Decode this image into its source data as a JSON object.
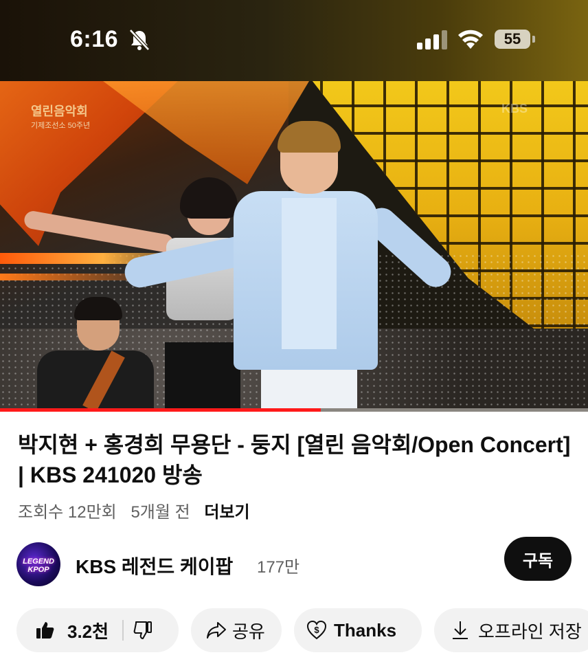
{
  "status_bar": {
    "time": "6:16",
    "battery": "55",
    "icons": [
      "bell-slash-icon",
      "signal-icon",
      "wifi-icon",
      "battery-icon"
    ]
  },
  "video": {
    "overlay_logo": "열린음악회",
    "overlay_sub": "기제조선소 50주년",
    "watermark": "KBS",
    "progress": 0.545
  },
  "details": {
    "title": "박지현 + 홍경희 무용단 - 둥지 [열린 음악회/Open Concert] | KBS 241020 방송",
    "views": "조회수 12만회",
    "age": "5개월 전",
    "more": "더보기"
  },
  "channel": {
    "avatar_text_1": "LEGEND",
    "avatar_text_2": "KPOP",
    "name": "KBS 레전드 케이팝",
    "subscribers": "177만",
    "subscribe_label": "구독"
  },
  "actions": {
    "like_count": "3.2천",
    "share_label": "공유",
    "thanks_label": "Thanks",
    "offline_label": "오프라인 저장"
  },
  "colors": {
    "accent_red": "#ff1a1a",
    "pill_bg": "#f2f2f2",
    "subscribe_bg": "#0f0f0f"
  }
}
